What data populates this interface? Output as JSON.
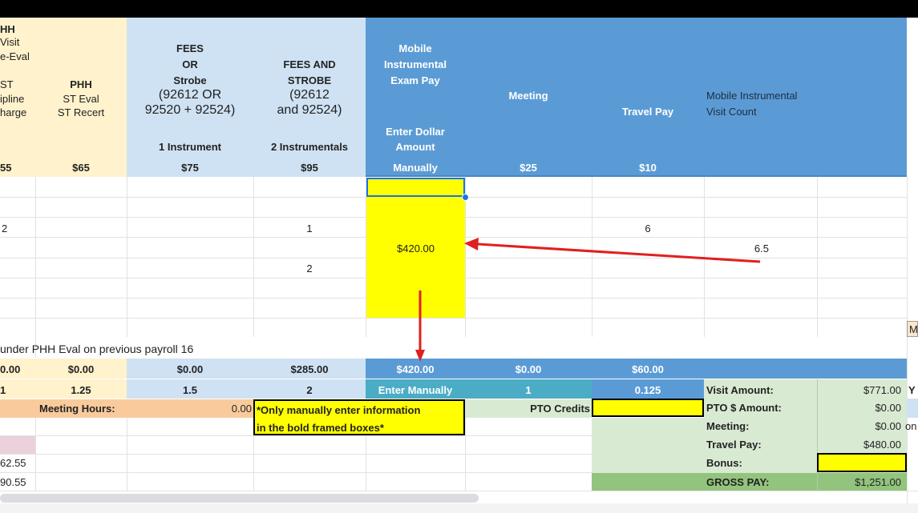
{
  "header": {
    "col_a": {
      "l1": "HH",
      "l2": "Visit",
      "l3": "e-Eval",
      "l4": "ST",
      "l5": "ipline",
      "l6": "harge",
      "price": "55"
    },
    "col_b": {
      "l1": "PHH",
      "l2": "ST Eval",
      "l3": "ST Recert",
      "price": "$65"
    },
    "col_c": {
      "l1": "FEES",
      "l2": "OR",
      "l3": "Strobe",
      "l4": "(92612 OR",
      "l5": "92520 + 92524)",
      "sub": "1 Instrument",
      "price": "$75"
    },
    "col_d": {
      "l1": "FEES AND",
      "l2": "STROBE",
      "l3": "(92612",
      "l4": "and 92524)",
      "sub": "2 Instrumentals",
      "price": "$95"
    },
    "col_e": {
      "l1": "Mobile",
      "l2": "Instrumental",
      "l3": "Exam Pay",
      "l4": "Enter Dollar",
      "l5": "Amount",
      "price": "Manually"
    },
    "col_f": {
      "label": "Meeting",
      "price": "$25"
    },
    "col_g": {
      "label": "Travel Pay",
      "price": "$10"
    },
    "col_h": {
      "l1": "Mobile Instrumental",
      "l2": "Visit Count"
    }
  },
  "rows": {
    "r1": {
      "a": "2",
      "d": "1",
      "g": "6"
    },
    "r2": {
      "e": "$420.00",
      "h": "6.5"
    },
    "r3": {
      "d": "2"
    },
    "edge_label": "M"
  },
  "note": "under PHH Eval on previous payroll 16",
  "totals": {
    "a": "0.00",
    "b": "$0.00",
    "c": "$0.00",
    "d": "$285.00",
    "e": "$420.00",
    "f": "$0.00",
    "g": "$60.00"
  },
  "rates": {
    "a": "1",
    "b": "1.25",
    "c": "1.5",
    "d": "2",
    "e": "Enter Manually",
    "f": "1",
    "g": "0.125"
  },
  "meeting_row": {
    "label": "Meeting Hours:",
    "value": "0.00",
    "instruction_l1": "*Only manually enter information",
    "instruction_l2": "in the bold framed boxes*",
    "pto_credits": "PTO Credits"
  },
  "summary": {
    "visit_amount_label": "Visit Amount:",
    "visit_amount": "$771.00",
    "edge1": "Y",
    "pto_label": "PTO $ Amount:",
    "pto": "$0.00",
    "meeting_label": "Meeting:",
    "meeting": "$0.00",
    "edge3": "on",
    "travel_label": "Travel Pay:",
    "travel": "$480.00",
    "bonus_label": "Bonus:",
    "gross_label": "GROSS PAY:",
    "gross": "$1,251.00"
  },
  "left_values": {
    "v1": "62.55",
    "v2": "90.55"
  },
  "colors": {
    "cream": "#fff2cc",
    "lightblue": "#cfe2f3",
    "blue": "#5b9bd5",
    "teal": "#4bacc6",
    "yellow": "#ffff00",
    "lightgreen": "#d9ead3",
    "green": "#93c47d",
    "orange": "#f9cb9c",
    "pink": "#ead1dc",
    "arrow": "#e0201f"
  }
}
